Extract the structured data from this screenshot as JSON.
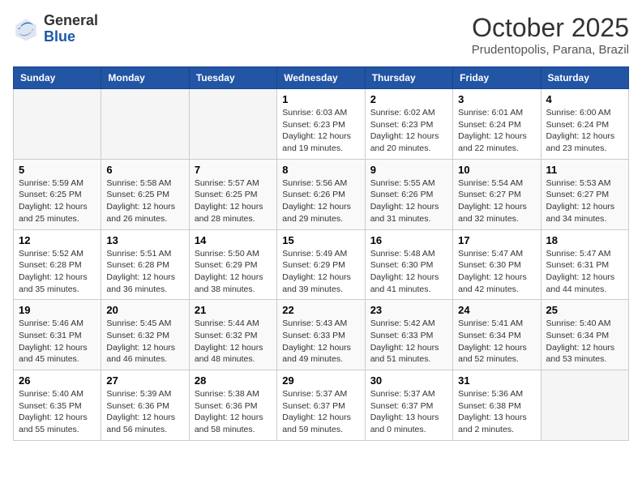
{
  "header": {
    "logo_general": "General",
    "logo_blue": "Blue",
    "month_title": "October 2025",
    "subtitle": "Prudentopolis, Parana, Brazil"
  },
  "days_of_week": [
    "Sunday",
    "Monday",
    "Tuesday",
    "Wednesday",
    "Thursday",
    "Friday",
    "Saturday"
  ],
  "weeks": [
    [
      {
        "day": "",
        "info": ""
      },
      {
        "day": "",
        "info": ""
      },
      {
        "day": "",
        "info": ""
      },
      {
        "day": "1",
        "info": "Sunrise: 6:03 AM\nSunset: 6:23 PM\nDaylight: 12 hours and 19 minutes."
      },
      {
        "day": "2",
        "info": "Sunrise: 6:02 AM\nSunset: 6:23 PM\nDaylight: 12 hours and 20 minutes."
      },
      {
        "day": "3",
        "info": "Sunrise: 6:01 AM\nSunset: 6:24 PM\nDaylight: 12 hours and 22 minutes."
      },
      {
        "day": "4",
        "info": "Sunrise: 6:00 AM\nSunset: 6:24 PM\nDaylight: 12 hours and 23 minutes."
      }
    ],
    [
      {
        "day": "5",
        "info": "Sunrise: 5:59 AM\nSunset: 6:25 PM\nDaylight: 12 hours and 25 minutes."
      },
      {
        "day": "6",
        "info": "Sunrise: 5:58 AM\nSunset: 6:25 PM\nDaylight: 12 hours and 26 minutes."
      },
      {
        "day": "7",
        "info": "Sunrise: 5:57 AM\nSunset: 6:25 PM\nDaylight: 12 hours and 28 minutes."
      },
      {
        "day": "8",
        "info": "Sunrise: 5:56 AM\nSunset: 6:26 PM\nDaylight: 12 hours and 29 minutes."
      },
      {
        "day": "9",
        "info": "Sunrise: 5:55 AM\nSunset: 6:26 PM\nDaylight: 12 hours and 31 minutes."
      },
      {
        "day": "10",
        "info": "Sunrise: 5:54 AM\nSunset: 6:27 PM\nDaylight: 12 hours and 32 minutes."
      },
      {
        "day": "11",
        "info": "Sunrise: 5:53 AM\nSunset: 6:27 PM\nDaylight: 12 hours and 34 minutes."
      }
    ],
    [
      {
        "day": "12",
        "info": "Sunrise: 5:52 AM\nSunset: 6:28 PM\nDaylight: 12 hours and 35 minutes."
      },
      {
        "day": "13",
        "info": "Sunrise: 5:51 AM\nSunset: 6:28 PM\nDaylight: 12 hours and 36 minutes."
      },
      {
        "day": "14",
        "info": "Sunrise: 5:50 AM\nSunset: 6:29 PM\nDaylight: 12 hours and 38 minutes."
      },
      {
        "day": "15",
        "info": "Sunrise: 5:49 AM\nSunset: 6:29 PM\nDaylight: 12 hours and 39 minutes."
      },
      {
        "day": "16",
        "info": "Sunrise: 5:48 AM\nSunset: 6:30 PM\nDaylight: 12 hours and 41 minutes."
      },
      {
        "day": "17",
        "info": "Sunrise: 5:47 AM\nSunset: 6:30 PM\nDaylight: 12 hours and 42 minutes."
      },
      {
        "day": "18",
        "info": "Sunrise: 5:47 AM\nSunset: 6:31 PM\nDaylight: 12 hours and 44 minutes."
      }
    ],
    [
      {
        "day": "19",
        "info": "Sunrise: 5:46 AM\nSunset: 6:31 PM\nDaylight: 12 hours and 45 minutes."
      },
      {
        "day": "20",
        "info": "Sunrise: 5:45 AM\nSunset: 6:32 PM\nDaylight: 12 hours and 46 minutes."
      },
      {
        "day": "21",
        "info": "Sunrise: 5:44 AM\nSunset: 6:32 PM\nDaylight: 12 hours and 48 minutes."
      },
      {
        "day": "22",
        "info": "Sunrise: 5:43 AM\nSunset: 6:33 PM\nDaylight: 12 hours and 49 minutes."
      },
      {
        "day": "23",
        "info": "Sunrise: 5:42 AM\nSunset: 6:33 PM\nDaylight: 12 hours and 51 minutes."
      },
      {
        "day": "24",
        "info": "Sunrise: 5:41 AM\nSunset: 6:34 PM\nDaylight: 12 hours and 52 minutes."
      },
      {
        "day": "25",
        "info": "Sunrise: 5:40 AM\nSunset: 6:34 PM\nDaylight: 12 hours and 53 minutes."
      }
    ],
    [
      {
        "day": "26",
        "info": "Sunrise: 5:40 AM\nSunset: 6:35 PM\nDaylight: 12 hours and 55 minutes."
      },
      {
        "day": "27",
        "info": "Sunrise: 5:39 AM\nSunset: 6:36 PM\nDaylight: 12 hours and 56 minutes."
      },
      {
        "day": "28",
        "info": "Sunrise: 5:38 AM\nSunset: 6:36 PM\nDaylight: 12 hours and 58 minutes."
      },
      {
        "day": "29",
        "info": "Sunrise: 5:37 AM\nSunset: 6:37 PM\nDaylight: 12 hours and 59 minutes."
      },
      {
        "day": "30",
        "info": "Sunrise: 5:37 AM\nSunset: 6:37 PM\nDaylight: 13 hours and 0 minutes."
      },
      {
        "day": "31",
        "info": "Sunrise: 5:36 AM\nSunset: 6:38 PM\nDaylight: 13 hours and 2 minutes."
      },
      {
        "day": "",
        "info": ""
      }
    ]
  ]
}
